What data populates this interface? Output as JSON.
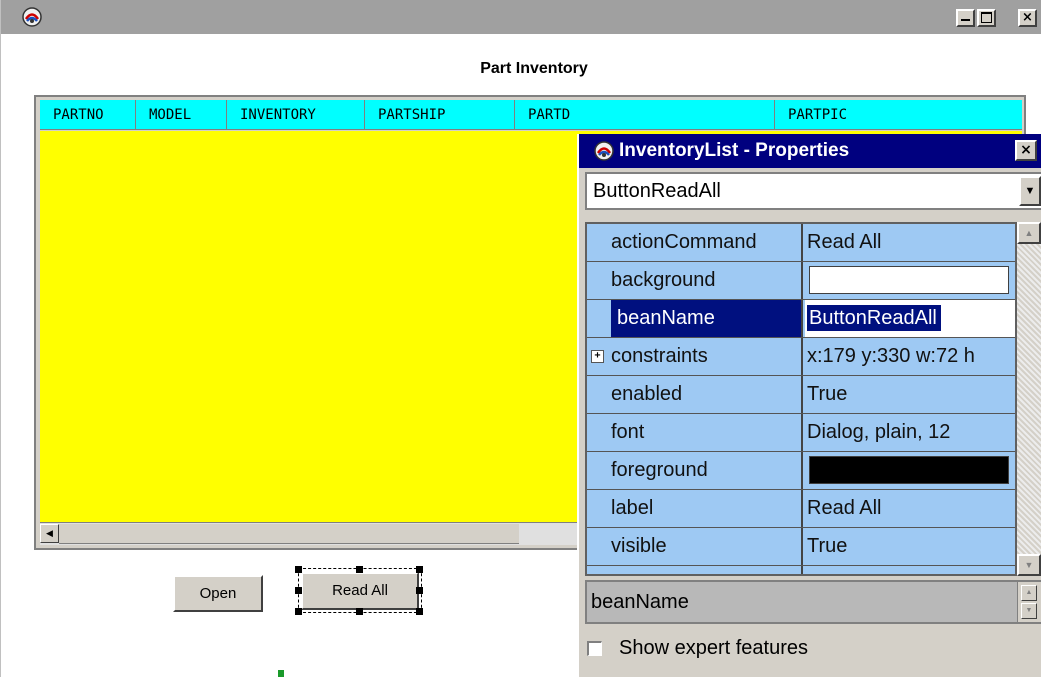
{
  "window": {
    "title": "",
    "min_glyph": "_",
    "max_glyph": "□",
    "close_glyph": "×"
  },
  "page": {
    "title": "Part Inventory"
  },
  "grid": {
    "columns": [
      "PARTNO",
      "MODEL",
      "INVENTORY",
      "PARTSHIP",
      "PARTD",
      "PARTPIC"
    ],
    "body_color": "#ffff00",
    "header_color": "#00ffff",
    "scroll_left_glyph": "◀"
  },
  "buttons": {
    "open": "Open",
    "read_all": "Read All"
  },
  "properties": {
    "title": "InventoryList - Properties",
    "close_glyph": "×",
    "bean_select": {
      "value": "ButtonReadAll",
      "arrow": "▼"
    },
    "rows": [
      {
        "name": "actionCommand",
        "value": "Read All"
      },
      {
        "name": "background",
        "value": "",
        "swatch": "#ffffff"
      },
      {
        "name": "beanName",
        "value": "ButtonReadAll",
        "selected": true
      },
      {
        "name": "constraints",
        "value": "x:179 y:330 w:72 h",
        "expandable": true,
        "expander": "+"
      },
      {
        "name": "enabled",
        "value": "True"
      },
      {
        "name": "font",
        "value": "Dialog, plain, 12"
      },
      {
        "name": "foreground",
        "value": "",
        "swatch": "#000000"
      },
      {
        "name": "label",
        "value": "Read All"
      },
      {
        "name": "visible",
        "value": "True"
      }
    ],
    "scroll_up": "▲",
    "scroll_down": "▼",
    "description": "beanName",
    "spin_up": "▲",
    "spin_down": "▼",
    "expert_checkbox_label": "Show expert features",
    "expert_checked": false,
    "header_color": "#00007f",
    "sheet_color": "#9ec9f3"
  }
}
